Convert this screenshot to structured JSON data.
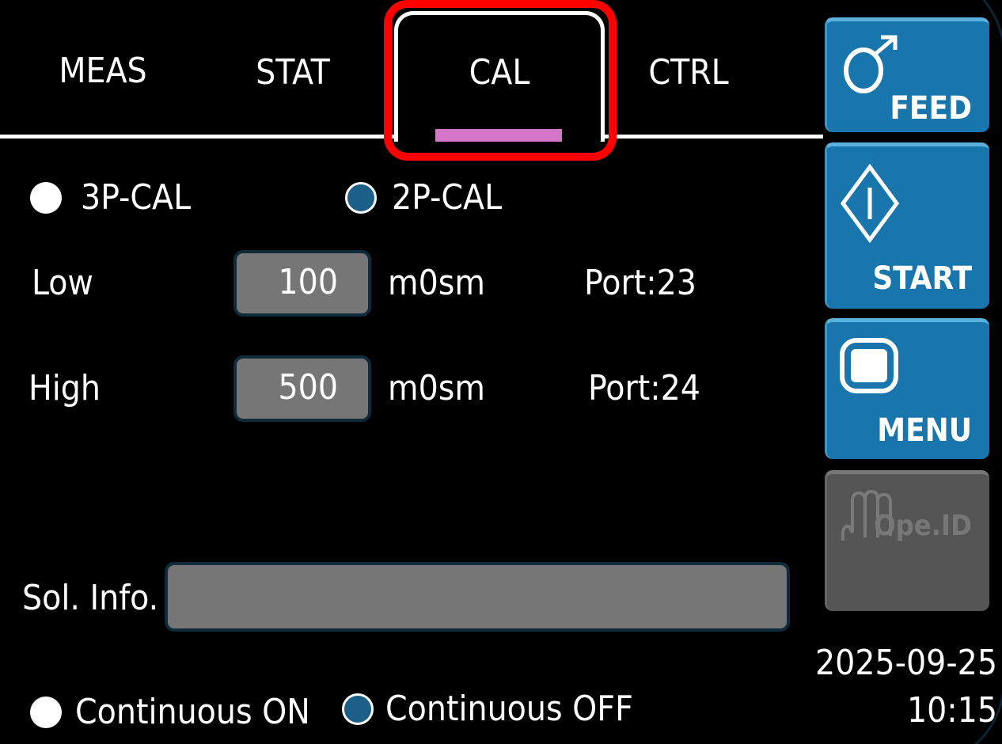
{
  "tabs": {
    "meas": "MEAS",
    "stat": "STAT",
    "cal": "CAL",
    "ctrl": "CTRL",
    "active": "CAL",
    "indicator_color": "#d477c8",
    "highlight_color": "#ff0000"
  },
  "cal_mode": {
    "option_3p": "3P-CAL",
    "option_2p": "2P-CAL",
    "selected": "2P-CAL"
  },
  "low": {
    "label": "Low",
    "value": "100",
    "unit": "m0sm",
    "port": "Port:23"
  },
  "high": {
    "label": "High",
    "value": "500",
    "unit": "m0sm",
    "port": "Port:24"
  },
  "sol_info": {
    "label": "Sol. Info.",
    "value": ""
  },
  "continuous": {
    "on_label": "Continuous ON",
    "off_label": "Continuous OFF",
    "selected": "Continuous OFF"
  },
  "side_buttons": {
    "feed": "FEED",
    "start": "START",
    "menu": "MENU",
    "ope_id": "Ope.ID",
    "ope_id_enabled": false
  },
  "datetime": {
    "date": "2025-09-25",
    "time": "10:15"
  },
  "colors": {
    "background": "#000000",
    "button_blue": "#1976ad",
    "field_gray": "#767676",
    "radio_selected": "#1c5f87",
    "disabled_gray": "#555555"
  },
  "icons": {
    "feed": "feed-arrow-circle-icon",
    "start": "start-diamond-icon",
    "menu": "menu-screen-icon",
    "ope_id": "operator-hand-icon"
  }
}
